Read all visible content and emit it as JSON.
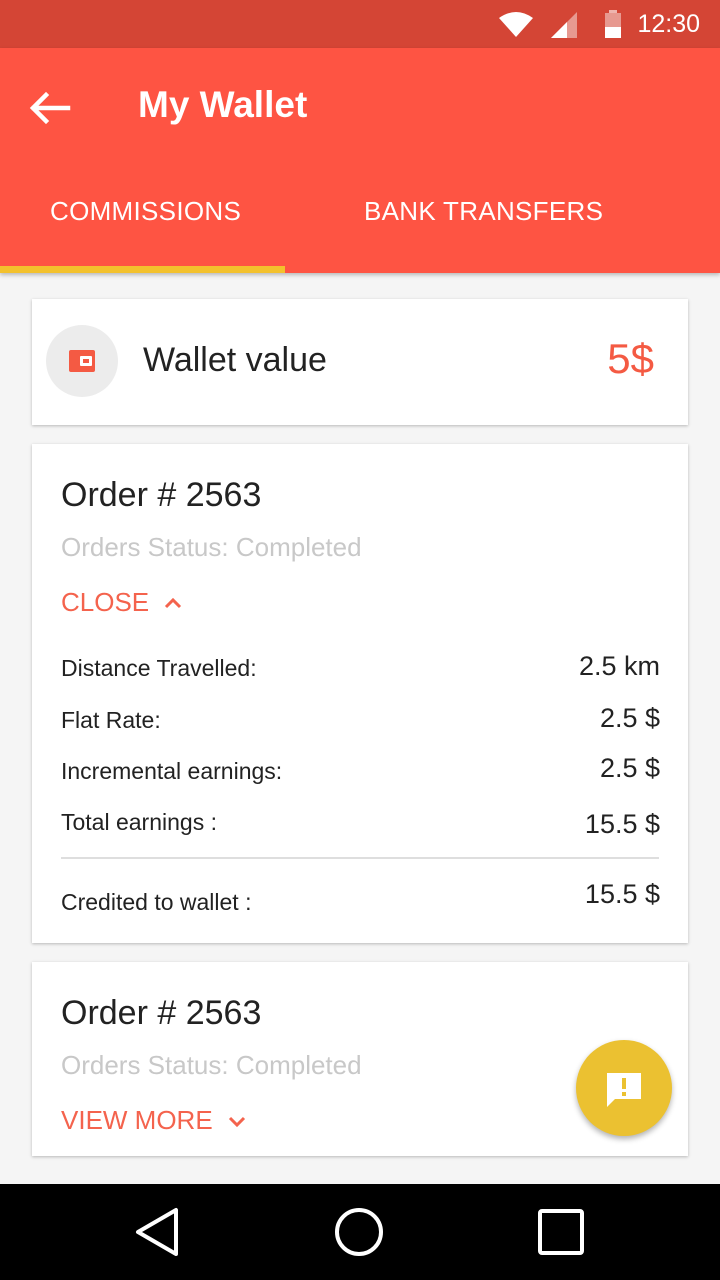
{
  "status_bar": {
    "time": "12:30"
  },
  "app_bar": {
    "title": "My Wallet"
  },
  "tabs": [
    {
      "label": "COMMISSIONS",
      "selected": true
    },
    {
      "label": "BANK TRANSFERS",
      "selected": false
    }
  ],
  "wallet": {
    "label": "Wallet value",
    "value": "5$"
  },
  "orders": [
    {
      "title": "Order # 2563",
      "status": "Orders Status: Completed",
      "toggle_label": "CLOSE",
      "expanded": true,
      "details": [
        {
          "label": "Distance Travelled:",
          "value": "2.5 km"
        },
        {
          "label": "Flat Rate:",
          "value": "2.5 $"
        },
        {
          "label": "Incremental earnings:",
          "value": "2.5 $"
        },
        {
          "label": "Total earnings :",
          "value": "15.5 $"
        }
      ],
      "credited": {
        "label": "Credited to wallet :",
        "value": "15.5 $"
      }
    },
    {
      "title": "Order # 2563",
      "status": "Orders Status: Completed",
      "toggle_label": "VIEW MORE",
      "expanded": false
    }
  ],
  "colors": {
    "status_bar": "#d44535",
    "app_bar": "#fe5443",
    "tab_indicator": "#f3c12d",
    "accent": "#f45a43",
    "fab": "#ebc131"
  },
  "icons": {
    "back": "arrow-left-icon",
    "wallet": "wallet-icon",
    "fab": "feedback-icon"
  }
}
